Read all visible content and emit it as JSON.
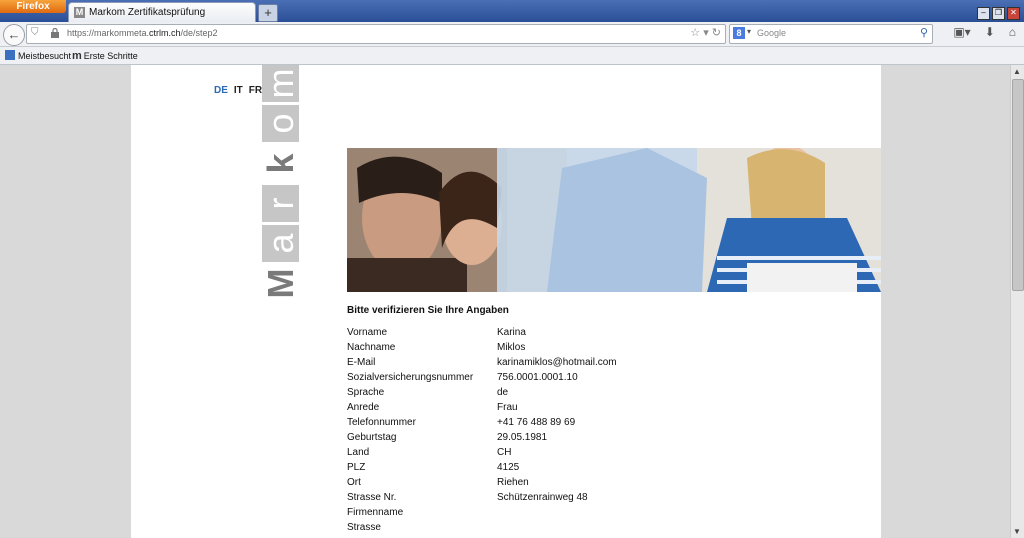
{
  "browser": {
    "app_button": "Firefox",
    "tab_title": "Markom Zertifikatsprüfung",
    "tab_favicon": "M",
    "new_tab": "+",
    "url_prefix": "https://markommeta.",
    "url_domain": "ctrlm.ch",
    "url_path": "/de/step2",
    "search_placeholder": "Google",
    "search_engine_icon": "8",
    "bookmarks": [
      {
        "label": "Meistbesucht",
        "icon": "bookmark-icon"
      },
      {
        "label": "Erste Schritte",
        "icon": "markom-icon"
      }
    ]
  },
  "page": {
    "languages": [
      {
        "code": "DE",
        "active": true
      },
      {
        "code": "IT",
        "active": false
      },
      {
        "code": "FR",
        "active": false
      }
    ],
    "logo_letters": [
      "m",
      "o",
      "k",
      "r",
      "a",
      "M"
    ],
    "section_title": "Bitte verifizieren Sie Ihre Angaben",
    "fields": [
      {
        "label": "Vorname",
        "value": "Karina"
      },
      {
        "label": "Nachname",
        "value": "Miklos"
      },
      {
        "label": "E-Mail",
        "value": "karinamiklos@hotmail.com"
      },
      {
        "label": "Sozialversicherungsnummer",
        "value": "756.0001.0001.10"
      },
      {
        "label": "Sprache",
        "value": "de"
      },
      {
        "label": "Anrede",
        "value": "Frau"
      },
      {
        "label": "Telefonnummer",
        "value": "+41 76 488 89 69"
      },
      {
        "label": "Geburtstag",
        "value": "29.05.1981"
      },
      {
        "label": "Land",
        "value": "CH"
      },
      {
        "label": "PLZ",
        "value": "4125"
      },
      {
        "label": "Ort",
        "value": "Riehen"
      },
      {
        "label": "Strasse Nr.",
        "value": "Schützenrainweg 48"
      },
      {
        "label": "Firmenname",
        "value": ""
      },
      {
        "label": "Strasse",
        "value": ""
      }
    ]
  },
  "colors": {
    "accent": "#2a6ab5",
    "firefox_orange": "#e8801f",
    "titlebar": "#2a4f96",
    "logo_gray": "#c6c6c6"
  }
}
